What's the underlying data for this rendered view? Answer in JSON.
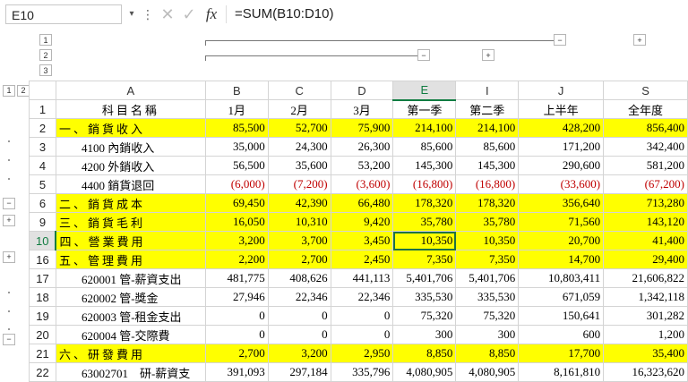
{
  "formula_bar": {
    "cell_ref": "E10",
    "formula": "=SUM(B10:D10)",
    "dots": "⋮",
    "cancel_glyph": "✕",
    "enter_glyph": "✓",
    "fx_label": "fx",
    "dropdown_glyph": "▾"
  },
  "outline": {
    "levels": [
      "1",
      "2",
      "3"
    ],
    "row_levels": [
      "1",
      "2"
    ],
    "collapse_glyph": "−",
    "expand_glyph": "+"
  },
  "columns": [
    "A",
    "B",
    "C",
    "D",
    "E",
    "I",
    "J",
    "S"
  ],
  "selected_column": "E",
  "header_row": {
    "row_num": "1",
    "cells": [
      "科目名稱",
      "1月",
      "2月",
      "3月",
      "第一季",
      "第二季",
      "上半年",
      "全年度"
    ]
  },
  "rows": [
    {
      "row_num": "2",
      "yellow": true,
      "cells": [
        "一、銷貨收入",
        "85,500",
        "52,700",
        "75,900",
        "214,100",
        "214,100",
        "428,200",
        "856,400"
      ]
    },
    {
      "row_num": "3",
      "yellow": false,
      "cells": [
        "4100 內銷收入",
        "35,000",
        "24,300",
        "26,300",
        "85,600",
        "85,600",
        "171,200",
        "342,400"
      ]
    },
    {
      "row_num": "4",
      "yellow": false,
      "cells": [
        "4200 外銷收入",
        "56,500",
        "35,600",
        "53,200",
        "145,300",
        "145,300",
        "290,600",
        "581,200"
      ]
    },
    {
      "row_num": "5",
      "yellow": false,
      "negative": true,
      "cells": [
        "4400 銷貨退回",
        "(6,000)",
        "(7,200)",
        "(3,600)",
        "(16,800)",
        "(16,800)",
        "(33,600)",
        "(67,200)"
      ]
    },
    {
      "row_num": "6",
      "yellow": true,
      "cells": [
        "二、銷貨成本",
        "69,450",
        "42,390",
        "66,480",
        "178,320",
        "178,320",
        "356,640",
        "713,280"
      ]
    },
    {
      "row_num": "9",
      "yellow": true,
      "cells": [
        "三、銷貨毛利",
        "16,050",
        "10,310",
        "9,420",
        "35,780",
        "35,780",
        "71,560",
        "143,120"
      ]
    },
    {
      "row_num": "10",
      "yellow": true,
      "selected": true,
      "cells": [
        "四、營業費用",
        "3,200",
        "3,700",
        "3,450",
        "10,350",
        "10,350",
        "20,700",
        "41,400"
      ]
    },
    {
      "row_num": "16",
      "yellow": true,
      "cells": [
        "五、管理費用",
        "2,200",
        "2,700",
        "2,450",
        "7,350",
        "7,350",
        "14,700",
        "29,400"
      ]
    },
    {
      "row_num": "17",
      "yellow": false,
      "cells": [
        "620001 管-薪資支出",
        "481,775",
        "408,626",
        "441,113",
        "5,401,706",
        "5,401,706",
        "10,803,411",
        "21,606,822"
      ]
    },
    {
      "row_num": "18",
      "yellow": false,
      "cells": [
        "620002 管-獎金",
        "27,946",
        "22,346",
        "22,346",
        "335,530",
        "335,530",
        "671,059",
        "1,342,118"
      ]
    },
    {
      "row_num": "19",
      "yellow": false,
      "cells": [
        "620003 管-租金支出",
        "0",
        "0",
        "0",
        "75,320",
        "75,320",
        "150,641",
        "301,282"
      ]
    },
    {
      "row_num": "20",
      "yellow": false,
      "cells": [
        "620004 管-交際費",
        "0",
        "0",
        "0",
        "300",
        "300",
        "600",
        "1,200"
      ]
    },
    {
      "row_num": "21",
      "yellow": true,
      "cells": [
        "六、研發費用",
        "2,700",
        "3,200",
        "2,950",
        "8,850",
        "8,850",
        "17,700",
        "35,400"
      ]
    },
    {
      "row_num": "22",
      "yellow": false,
      "cells": [
        "63002701　研-薪資支",
        "391,093",
        "297,184",
        "335,796",
        "4,080,905",
        "4,080,905",
        "8,161,810",
        "16,323,620"
      ]
    }
  ],
  "colors": {
    "yellow_fill": "#ffff00",
    "negative_text": "#c00000",
    "selection_green": "#107c41"
  }
}
